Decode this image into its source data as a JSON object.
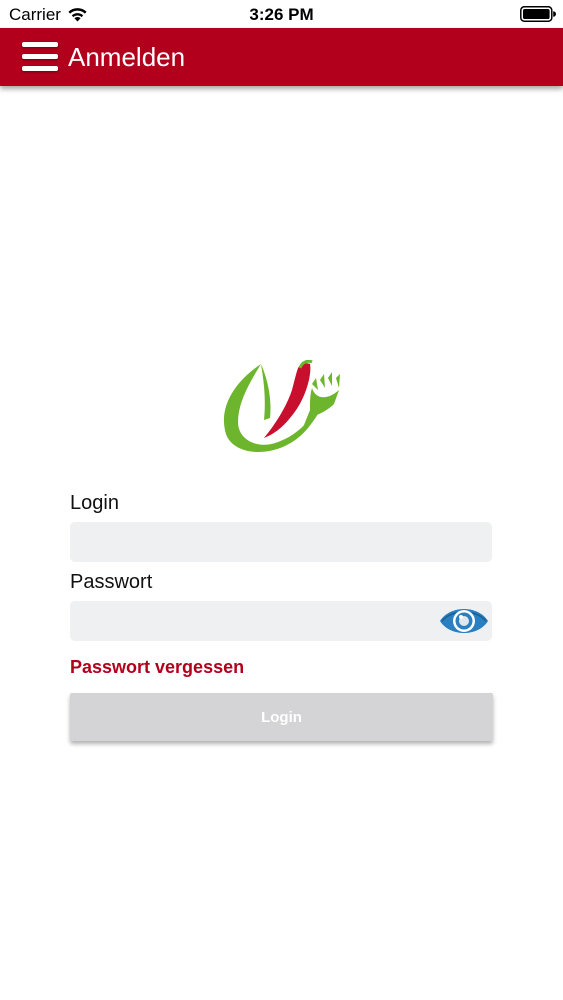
{
  "status_bar": {
    "carrier": "Carrier",
    "time": "3:26 PM",
    "wifi_icon": "wifi-icon",
    "battery_icon": "battery-icon"
  },
  "app_bar": {
    "title": "Anmelden",
    "menu_icon": "hamburger-menu-icon",
    "background_color": "#b2001c"
  },
  "logo": {
    "icon": "leaf-chili-fork-logo",
    "colors": {
      "green": "#6cb52d",
      "red": "#c8102e"
    }
  },
  "form": {
    "login_label": "Login",
    "login_value": "",
    "password_label": "Passwort",
    "password_value": "",
    "password_toggle_icon": "eye-icon",
    "forgot_password": "Passwort vergessen",
    "submit_label": "Login",
    "submit_enabled": false
  }
}
